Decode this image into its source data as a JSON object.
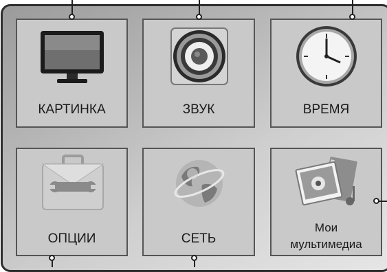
{
  "menu": {
    "tiles": [
      {
        "label": "КАРТИНКА",
        "icon": "monitor-icon"
      },
      {
        "label": "ЗВУК",
        "icon": "speaker-icon"
      },
      {
        "label": "ВРЕМЯ",
        "icon": "clock-icon"
      },
      {
        "label": "ОПЦИИ",
        "icon": "toolbox-icon"
      },
      {
        "label": "СЕТЬ",
        "icon": "globe-icon"
      },
      {
        "label_line1": "Мои",
        "label_line2": "мультимедиа",
        "icon": "photo-media-icon"
      }
    ]
  }
}
